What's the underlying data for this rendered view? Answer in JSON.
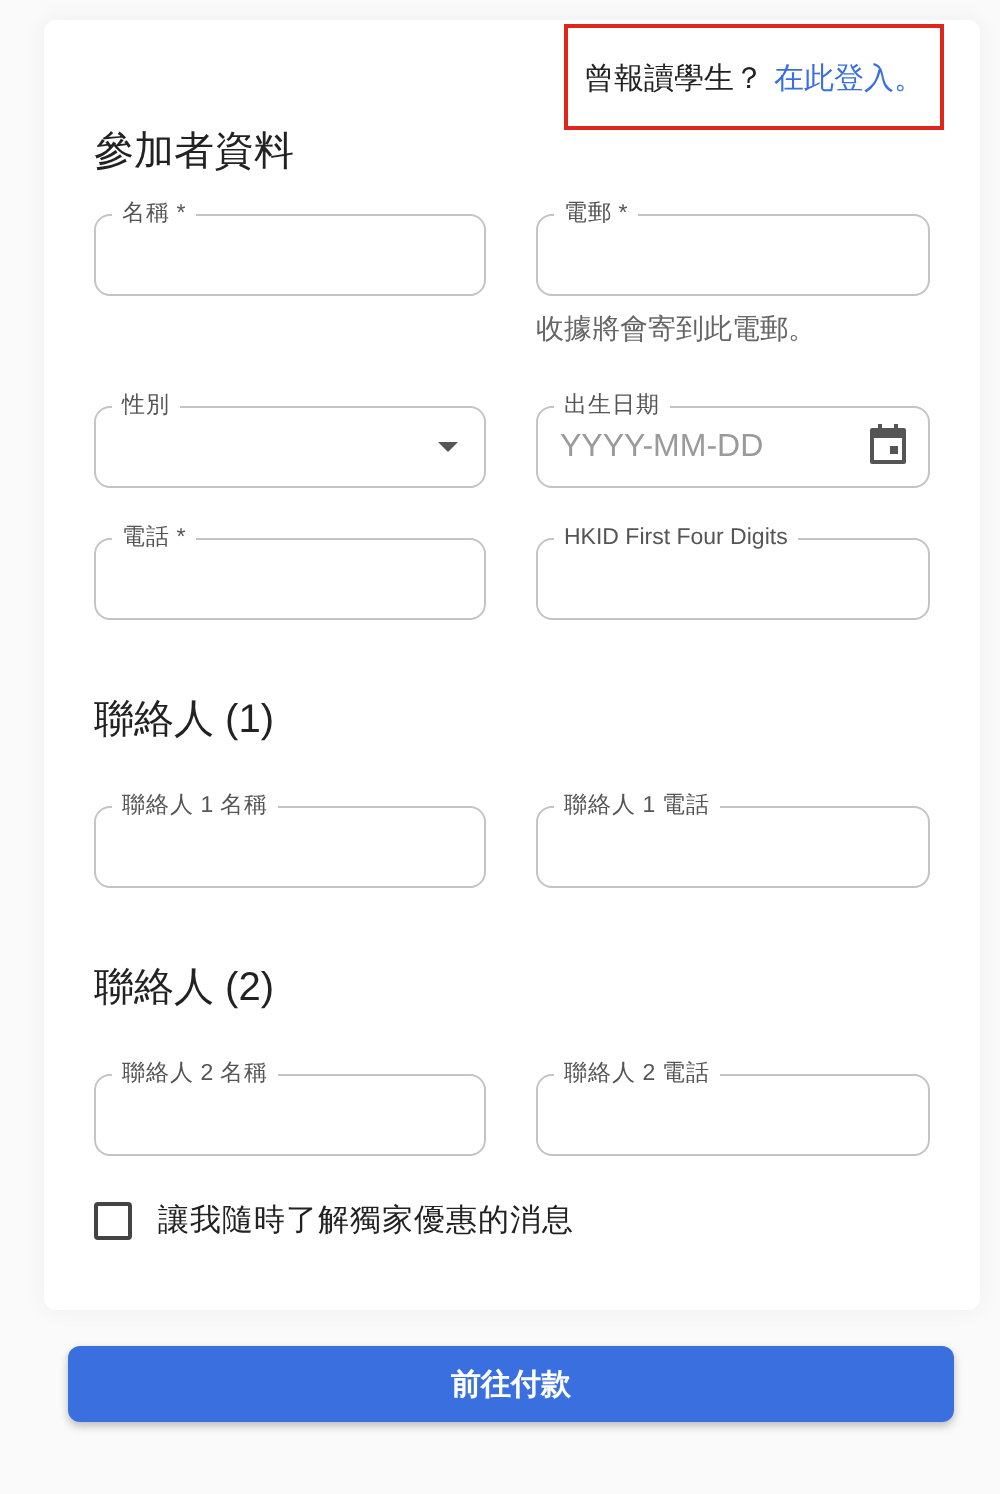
{
  "login_prompt": {
    "text": "曾報讀學生？",
    "link": "在此登入。"
  },
  "sections": [
    {
      "title": "參加者資料",
      "fields": [
        {
          "kind": "text",
          "label": "名稱 *"
        },
        {
          "kind": "text",
          "label": "電郵 *",
          "helper": "收據將會寄到此電郵。"
        },
        {
          "kind": "select",
          "label": "性別"
        },
        {
          "kind": "date",
          "label": "出生日期",
          "placeholder": "YYYY-MM-DD"
        },
        {
          "kind": "text",
          "label": "電話 *"
        },
        {
          "kind": "text",
          "label": "HKID First Four Digits"
        }
      ]
    },
    {
      "title": "聯絡人 (1)",
      "fields": [
        {
          "kind": "text",
          "label": "聯絡人 1 名稱"
        },
        {
          "kind": "text",
          "label": "聯絡人 1 電話"
        }
      ]
    },
    {
      "title": "聯絡人 (2)",
      "fields": [
        {
          "kind": "text",
          "label": "聯絡人 2 名稱"
        },
        {
          "kind": "text",
          "label": "聯絡人 2 電話"
        }
      ]
    }
  ],
  "marketing": {
    "label": "讓我隨時了解獨家優惠的消息",
    "checked": false
  },
  "submit": "前往付款"
}
